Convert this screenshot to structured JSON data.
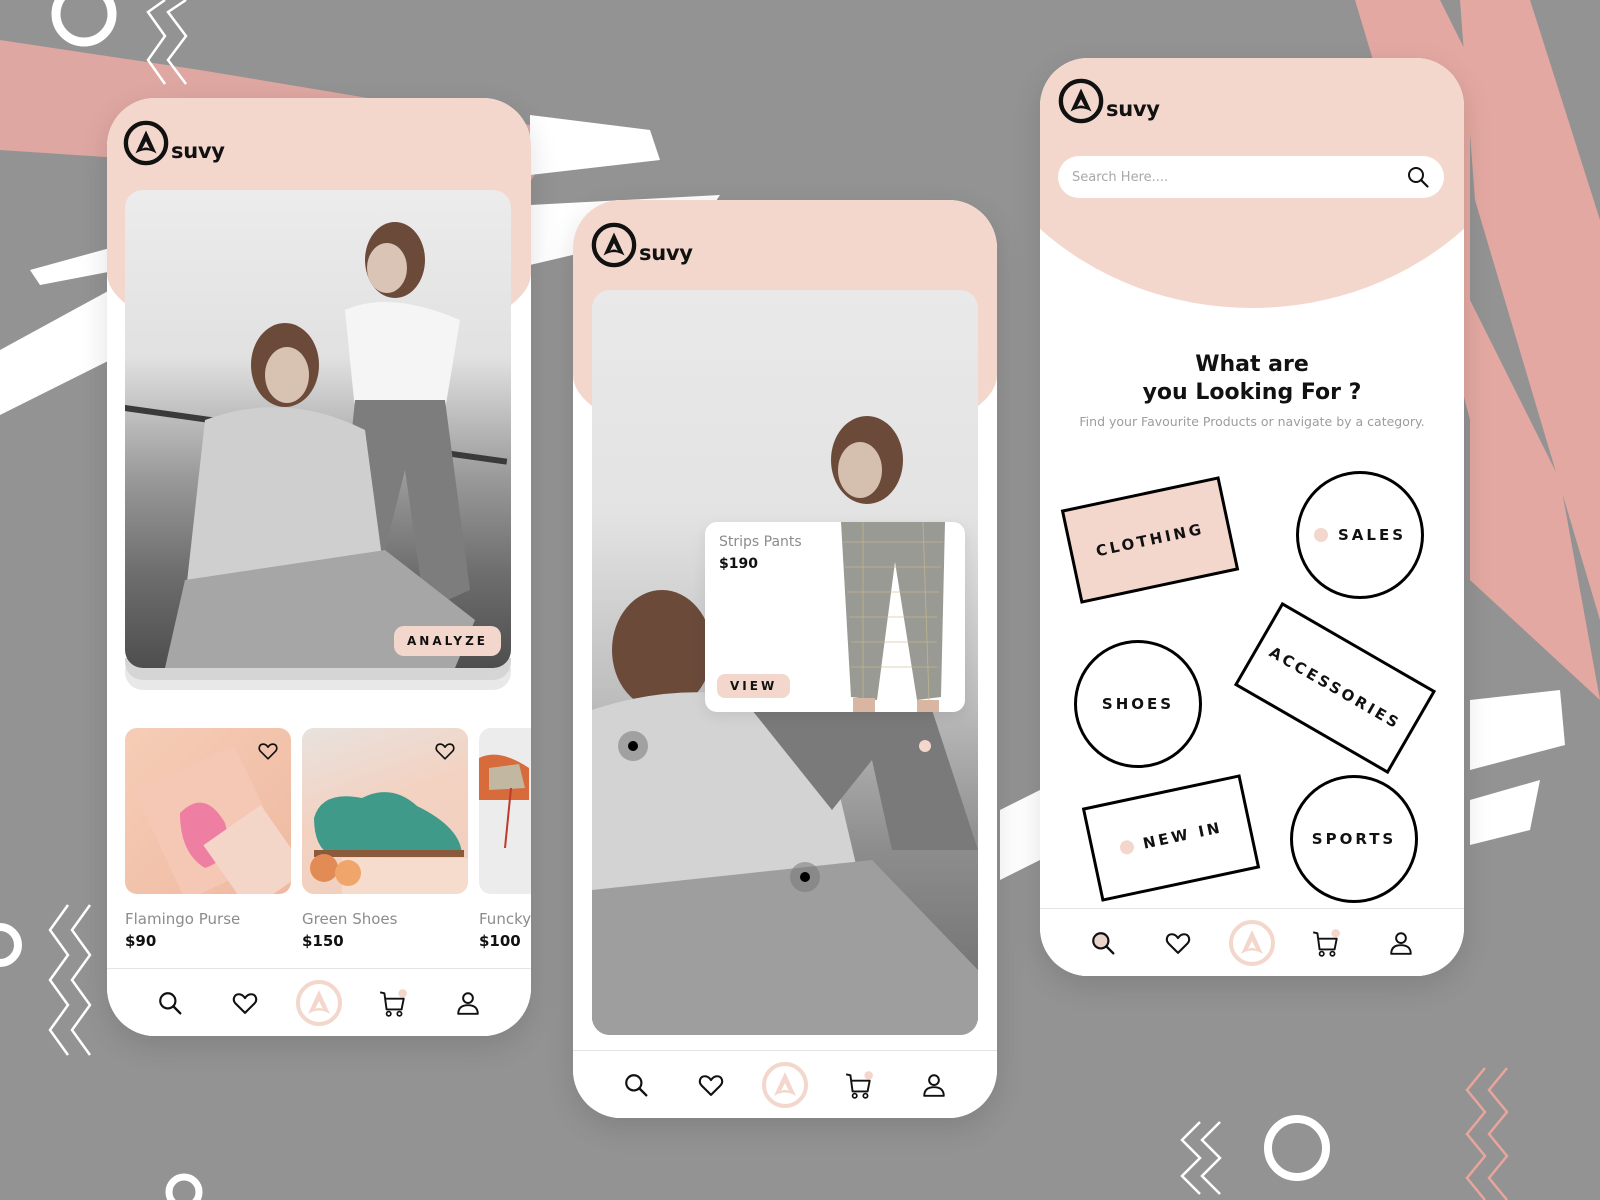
{
  "brand": {
    "name": "suvy",
    "accent_color": "#f3d7cc",
    "background_color": "#939393"
  },
  "screens": [
    {
      "id": "home",
      "hero": {
        "button_label": "ANALYZE"
      },
      "products": [
        {
          "name": "Flamingo Purse",
          "price": "$90",
          "icon": "heart-icon"
        },
        {
          "name": "Green Shoes",
          "price": "$150",
          "icon": "heart-icon"
        },
        {
          "name": "Funcky",
          "price": "$100",
          "icon": "heart-icon"
        }
      ]
    },
    {
      "id": "analyze",
      "popup": {
        "name": "Strips Pants",
        "price": "$190",
        "button_label": "VIEW"
      }
    },
    {
      "id": "search",
      "search": {
        "placeholder": "Search Here...."
      },
      "headline_line1": "What are",
      "headline_line2": "you Looking For ?",
      "subline": "Find your Favourite Products or navigate by a category.",
      "categories": [
        {
          "label": "CLOTHING",
          "shape": "rectangle",
          "filled": true,
          "dot": false
        },
        {
          "label": "SALES",
          "shape": "circle",
          "filled": false,
          "dot": true
        },
        {
          "label": "SHOES",
          "shape": "circle",
          "filled": false,
          "dot": false
        },
        {
          "label": "ACCESSORIES",
          "shape": "rectangle",
          "filled": false,
          "dot": false
        },
        {
          "label": "NEW IN",
          "shape": "rectangle",
          "filled": false,
          "dot": true
        },
        {
          "label": "SPORTS",
          "shape": "circle",
          "filled": false,
          "dot": false
        }
      ]
    }
  ],
  "bottom_nav": {
    "items": [
      {
        "name": "search",
        "icon": "search-icon"
      },
      {
        "name": "favorites",
        "icon": "heart-icon"
      },
      {
        "name": "home",
        "icon": "suvy-logo-icon"
      },
      {
        "name": "cart",
        "icon": "cart-icon",
        "badge": true
      },
      {
        "name": "profile",
        "icon": "user-icon"
      }
    ]
  }
}
